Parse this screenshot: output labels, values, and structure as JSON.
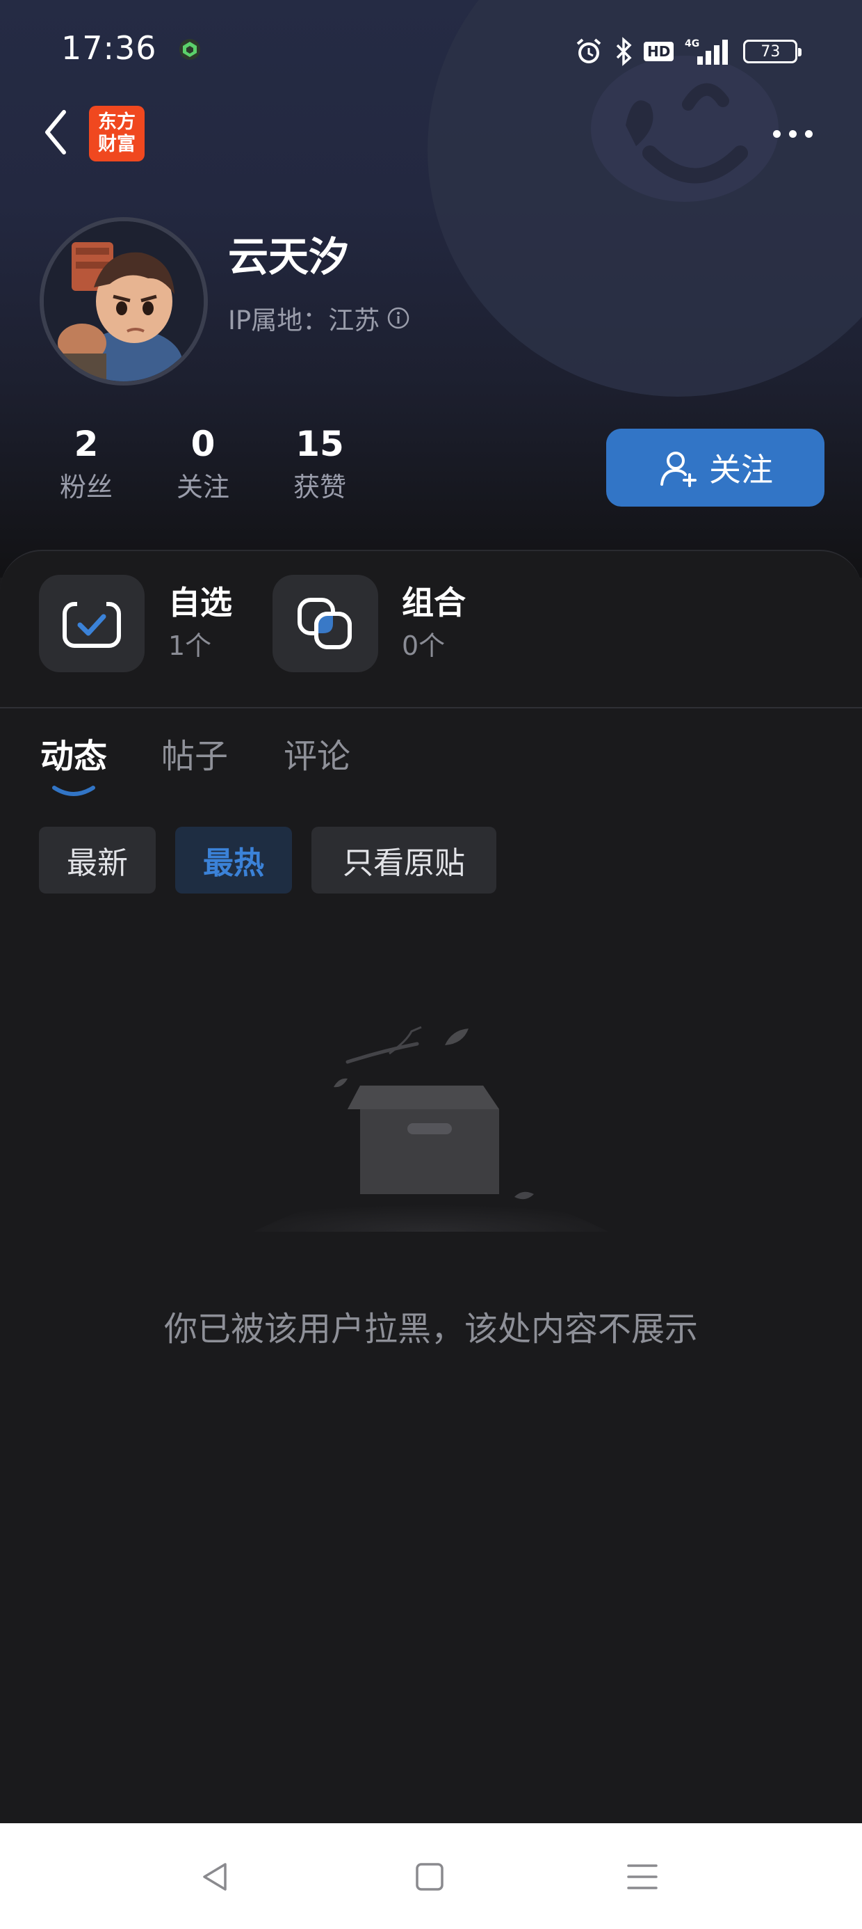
{
  "status_bar": {
    "time": "17:36",
    "network": "4G",
    "hd_badge": "HD",
    "battery": "73",
    "icons": [
      "app-shield-icon",
      "alarm-icon",
      "bluetooth-icon",
      "hd-icon",
      "signal-icon",
      "battery-icon"
    ]
  },
  "top_nav": {
    "back_icon": "chevron-left-icon",
    "logo_line1": "东方",
    "logo_line2": "财富",
    "more_icon": "more-dots-icon"
  },
  "profile": {
    "name": "云天汐",
    "ip_label": "IP属地：江苏",
    "avatar": "avatar-cartoon-boy"
  },
  "stats": [
    {
      "value": "2",
      "label": "粉丝"
    },
    {
      "value": "0",
      "label": "关注"
    },
    {
      "value": "15",
      "label": "获赞"
    }
  ],
  "follow_button": {
    "label": "关注",
    "icon": "add-user-icon"
  },
  "assets": [
    {
      "title": "自选",
      "count": "1个",
      "icon": "watchlist-check-icon"
    },
    {
      "title": "组合",
      "count": "0个",
      "icon": "portfolio-icon"
    }
  ],
  "tabs": [
    {
      "label": "动态",
      "active": true
    },
    {
      "label": "帖子",
      "active": false
    },
    {
      "label": "评论",
      "active": false
    }
  ],
  "filters": [
    {
      "label": "最新",
      "active": false
    },
    {
      "label": "最热",
      "active": true
    },
    {
      "label": "只看原贴",
      "active": false
    }
  ],
  "empty_state": {
    "message": "你已被该用户拉黑，该处内容不展示",
    "illustration": "empty-box-illustration"
  },
  "nav_bar": {
    "icons": [
      "back-triangle-icon",
      "home-square-icon",
      "menu-lines-icon"
    ]
  },
  "colors": {
    "accent": "#3275c6",
    "active_chip_text": "#3b82d8",
    "background": "#1a1a1c",
    "header_gradient_top": "#252b44",
    "logo_orange": "#f0481f"
  }
}
